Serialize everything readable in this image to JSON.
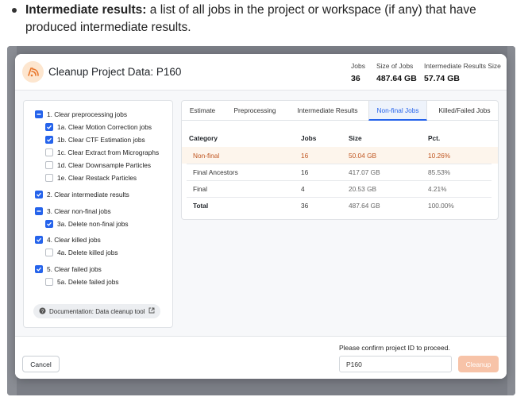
{
  "doc": {
    "bold_lead": "Intermediate results:",
    "text": " a list of all jobs in the project or workspace (if any) that have produced intermediate results."
  },
  "modal": {
    "title": "Cleanup Project Data: P160",
    "stats": [
      {
        "label": "Jobs",
        "value": "36"
      },
      {
        "label": "Size of Jobs",
        "value": "487.64 GB"
      },
      {
        "label": "Intermediate Results Size",
        "value": "57.74 GB"
      }
    ],
    "options": [
      {
        "label": "1. Clear preprocessing jobs",
        "state": "indeterminate"
      },
      {
        "label": "1a. Clear Motion Correction jobs",
        "state": "checked"
      },
      {
        "label": "1b. Clear CTF Estimation jobs",
        "state": "checked"
      },
      {
        "label": "1c. Clear Extract from Micrographs",
        "state": "unchecked"
      },
      {
        "label": "1d. Clear Downsample Particles",
        "state": "unchecked"
      },
      {
        "label": "1e. Clear Restack Particles",
        "state": "unchecked"
      },
      {
        "label": "2. Clear intermediate results",
        "state": "checked"
      },
      {
        "label": "3. Clear non-final jobs",
        "state": "indeterminate"
      },
      {
        "label": "3a. Delete non-final jobs",
        "state": "checked"
      },
      {
        "label": "4. Clear killed jobs",
        "state": "checked"
      },
      {
        "label": "4a. Delete killed jobs",
        "state": "unchecked"
      },
      {
        "label": "5. Clear failed jobs",
        "state": "checked"
      },
      {
        "label": "5a. Delete failed jobs",
        "state": "unchecked"
      }
    ],
    "doc_link": "Documentation: Data cleanup tool",
    "tabs": [
      "Estimate",
      "Preprocessing",
      "Intermediate Results",
      "Non-final Jobs",
      "Killed/Failed Jobs"
    ],
    "active_tab": "Non-final Jobs",
    "table": {
      "headers": [
        "Category",
        "Jobs",
        "Size",
        "Pct."
      ],
      "rows": [
        {
          "category": "Non-final",
          "jobs": "16",
          "size": "50.04 GB",
          "pct": "10.26%"
        },
        {
          "category": "Final Ancestors",
          "jobs": "16",
          "size": "417.07 GB",
          "pct": "85.53%"
        },
        {
          "category": "Final",
          "jobs": "4",
          "size": "20.53 GB",
          "pct": "4.21%"
        },
        {
          "category": "Total",
          "jobs": "36",
          "size": "487.64 GB",
          "pct": "100.00%"
        }
      ]
    },
    "footer": {
      "cancel_label": "Cancel",
      "confirm_label": "Please confirm project ID to proceed.",
      "confirm_value": "P160",
      "cleanup_label": "Cleanup"
    }
  },
  "colors": {
    "accent": "#2563eb",
    "highlight_text": "#c05621",
    "cleanup_button": "#f7c3a8"
  }
}
